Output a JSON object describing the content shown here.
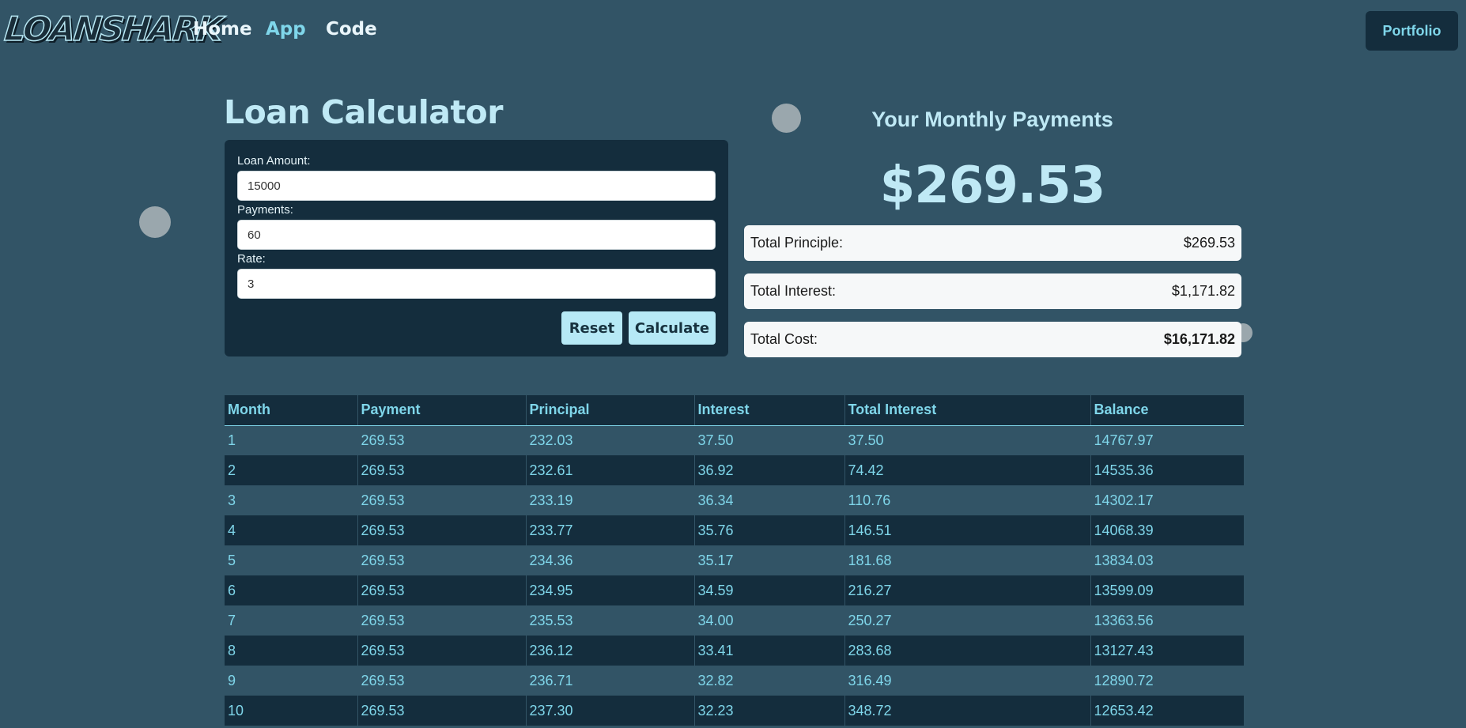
{
  "nav": {
    "logo": "LOANSHARK",
    "links": [
      "Home",
      "App",
      "Code"
    ],
    "active": "App",
    "portfolio_label": "Portfolio"
  },
  "calculator": {
    "title": "Loan Calculator",
    "fields": [
      {
        "label": "Loan Amount:",
        "value": "15000"
      },
      {
        "label": "Payments:",
        "value": "60"
      },
      {
        "label": "Rate:",
        "value": "3"
      }
    ],
    "reset_label": "Reset",
    "calculate_label": "Calculate"
  },
  "results": {
    "title": "Your Monthly Payments",
    "monthly_payment": "$269.53",
    "rows": [
      {
        "label": "Total Principle:",
        "value": "$269.53"
      },
      {
        "label": "Total Interest:",
        "value": "$1,171.82"
      },
      {
        "label": "Total Cost:",
        "value": "$16,171.82"
      }
    ]
  },
  "schedule": {
    "headers": [
      "Month",
      "Payment",
      "Principal",
      "Interest",
      "Total Interest",
      "Balance"
    ],
    "rows": [
      [
        "1",
        "269.53",
        "232.03",
        "37.50",
        "37.50",
        "14767.97"
      ],
      [
        "2",
        "269.53",
        "232.61",
        "36.92",
        "74.42",
        "14535.36"
      ],
      [
        "3",
        "269.53",
        "233.19",
        "36.34",
        "110.76",
        "14302.17"
      ],
      [
        "4",
        "269.53",
        "233.77",
        "35.76",
        "146.51",
        "14068.39"
      ],
      [
        "5",
        "269.53",
        "234.36",
        "35.17",
        "181.68",
        "13834.03"
      ],
      [
        "6",
        "269.53",
        "234.95",
        "34.59",
        "216.27",
        "13599.09"
      ],
      [
        "7",
        "269.53",
        "235.53",
        "34.00",
        "250.27",
        "13363.56"
      ],
      [
        "8",
        "269.53",
        "236.12",
        "33.41",
        "283.68",
        "13127.43"
      ],
      [
        "9",
        "269.53",
        "236.71",
        "32.82",
        "316.49",
        "12890.72"
      ],
      [
        "10",
        "269.53",
        "237.30",
        "32.23",
        "348.72",
        "12653.42"
      ]
    ]
  },
  "colors": {
    "background": "#325466",
    "panel": "#142d3d",
    "accent": "#7fd6ea",
    "button": "#b6e9f6"
  }
}
